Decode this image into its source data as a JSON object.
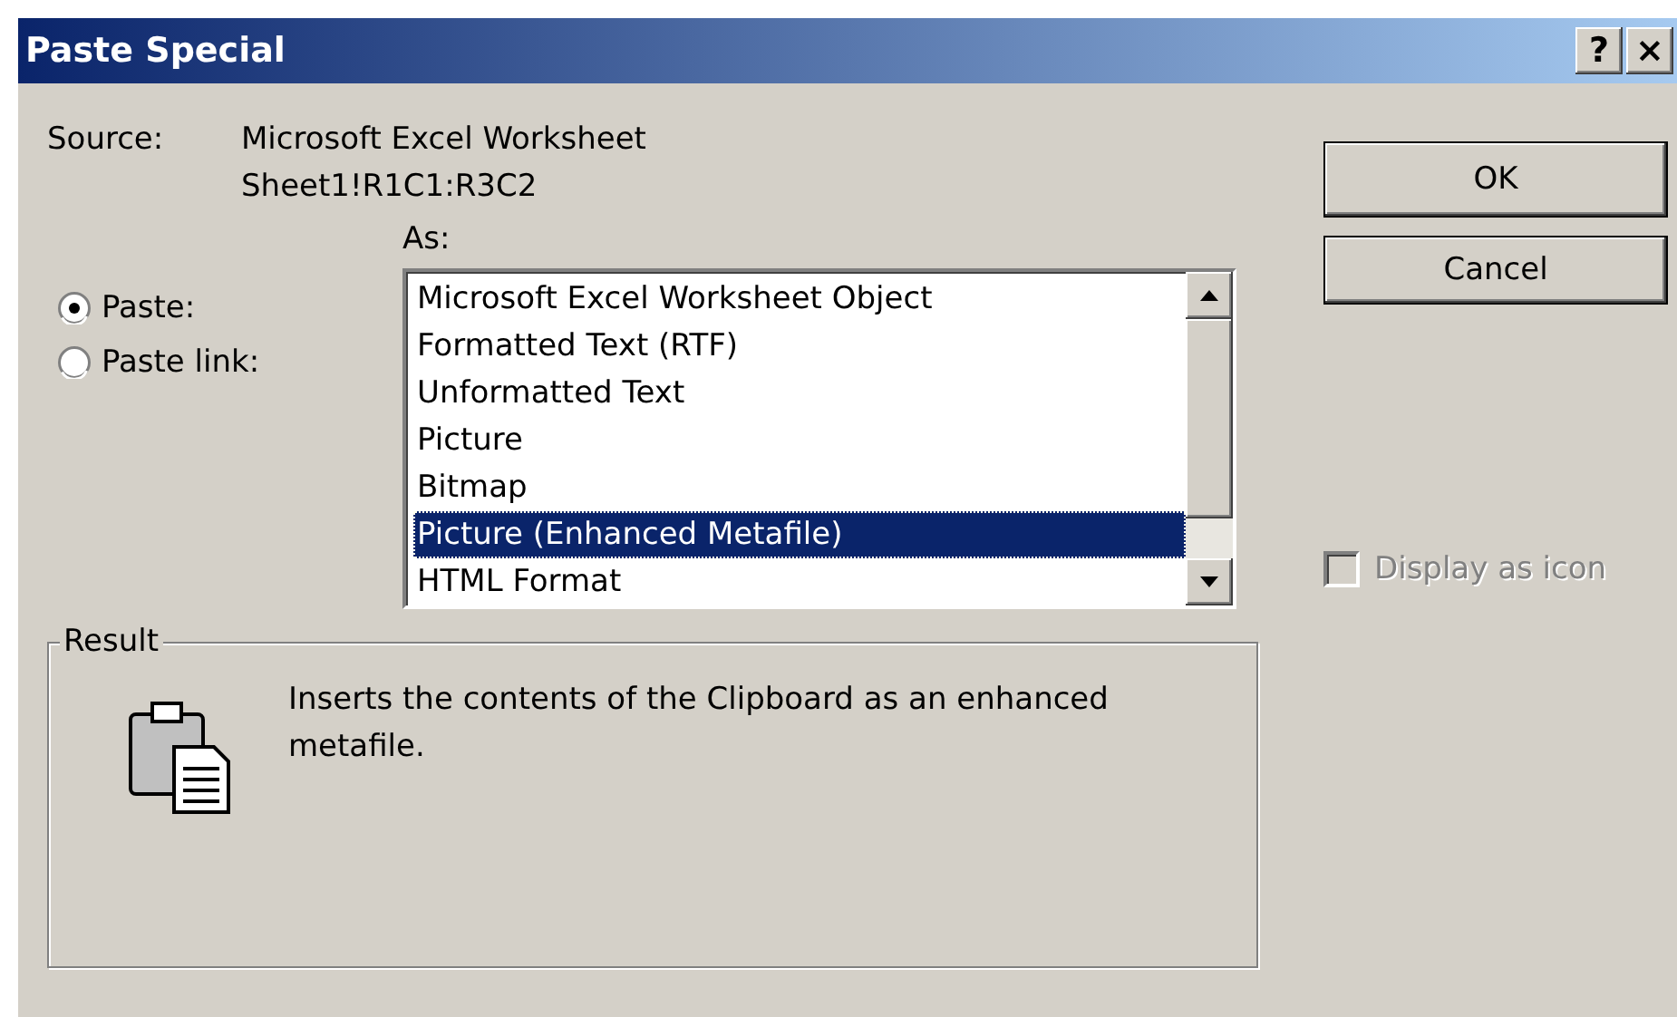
{
  "window": {
    "title": "Paste Special",
    "help_button": "?",
    "close_button": "×"
  },
  "source": {
    "label": "Source:",
    "lines": [
      "Microsoft Excel Worksheet",
      "Sheet1!R1C1:R3C2"
    ]
  },
  "paste_options": [
    {
      "label": "Paste:",
      "selected": true
    },
    {
      "label": "Paste link:",
      "selected": false
    }
  ],
  "as_list": {
    "label": "As:",
    "items": [
      {
        "label": "Microsoft Excel Worksheet Object",
        "selected": false
      },
      {
        "label": "Formatted Text (RTF)",
        "selected": false
      },
      {
        "label": "Unformatted Text",
        "selected": false
      },
      {
        "label": "Picture",
        "selected": false
      },
      {
        "label": "Bitmap",
        "selected": false
      },
      {
        "label": "Picture (Enhanced Metafile)",
        "selected": true
      },
      {
        "label": "HTML Format",
        "selected": false
      }
    ]
  },
  "buttons": [
    "OK",
    "Cancel"
  ],
  "display_as_icon": {
    "label": "Display as icon",
    "checked": false,
    "disabled": true
  },
  "result": {
    "label": "Result",
    "text": "Inserts the contents of the Clipboard as an enhanced metafile."
  }
}
